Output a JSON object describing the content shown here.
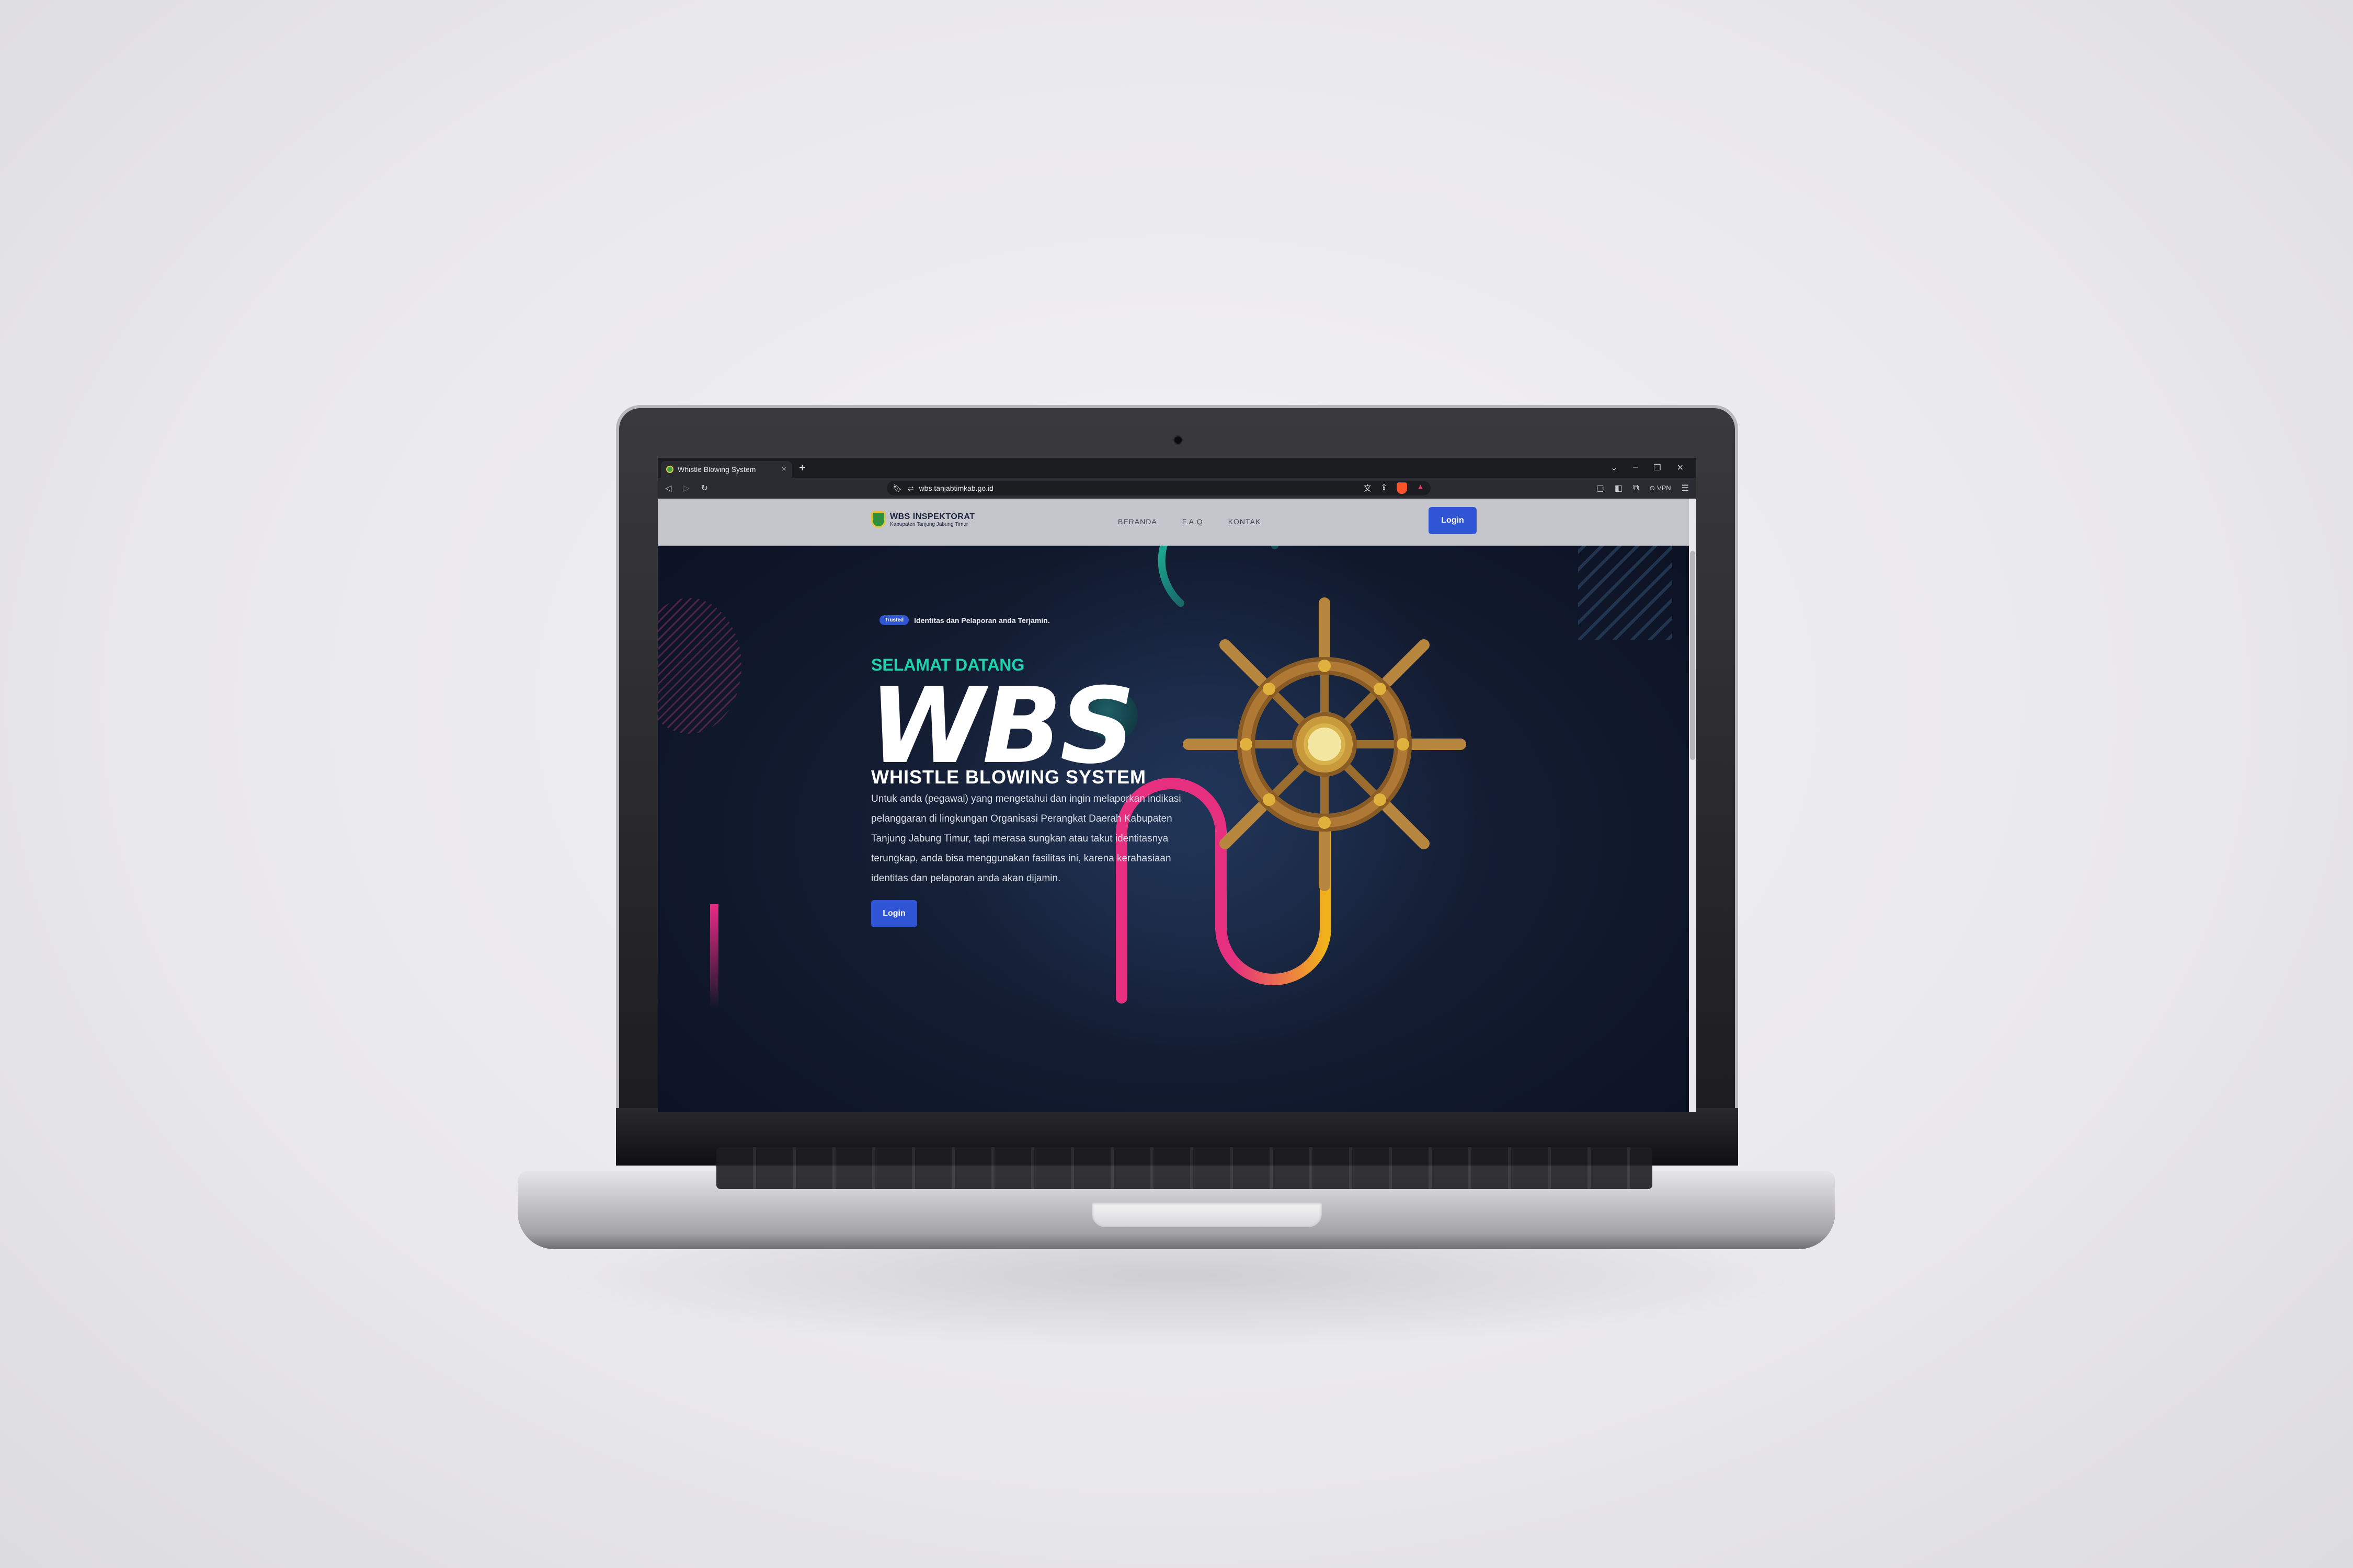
{
  "browser": {
    "tab_title": "Whistle Blowing System",
    "new_tab_symbol": "+",
    "tab_close_symbol": "×",
    "url": "wbs.tanjabtimkab.go.id",
    "vpn_label": "VPN"
  },
  "navbar": {
    "brand_title": "WBS INSPEKTORAT",
    "brand_subtitle": "Kabupaten Tanjung Jabung Timur",
    "links": [
      "BERANDA",
      "F.A.Q",
      "KONTAK"
    ],
    "login_label": "Login"
  },
  "hero": {
    "badge": "Trusted",
    "badge_text": "Identitas dan Pelaporan anda Terjamin.",
    "welcome": "SELAMAT DATANG",
    "headline": "WBS",
    "subtitle": "WHISTLE BLOWING SYSTEM",
    "description": "Untuk anda (pegawai) yang mengetahui dan ingin melaporkan indikasi pelanggaran di lingkungan Organisasi Perangkat Daerah Kabupaten Tanjung Jabung Timur, tapi merasa sungkan atau takut identitasnya terungkap, anda bisa menggunakan fasilitas ini, karena kerahasiaan identitas dan pelaporan anda akan dijamin.",
    "login_label": "Login"
  },
  "colors": {
    "accent_blue": "#2f55d4",
    "welcome_teal": "#1fd1ad",
    "background": "#131c31",
    "navbar": "#c4c6cb"
  },
  "icons": [
    "back-icon",
    "forward-icon",
    "reload-icon",
    "bookmark-icon",
    "site-info-icon",
    "translate-icon",
    "share-icon",
    "brave-shield-icon",
    "rewards-icon",
    "wallet-icon",
    "sidebar-icon",
    "menu-icon",
    "ship-wheel-illustration"
  ]
}
